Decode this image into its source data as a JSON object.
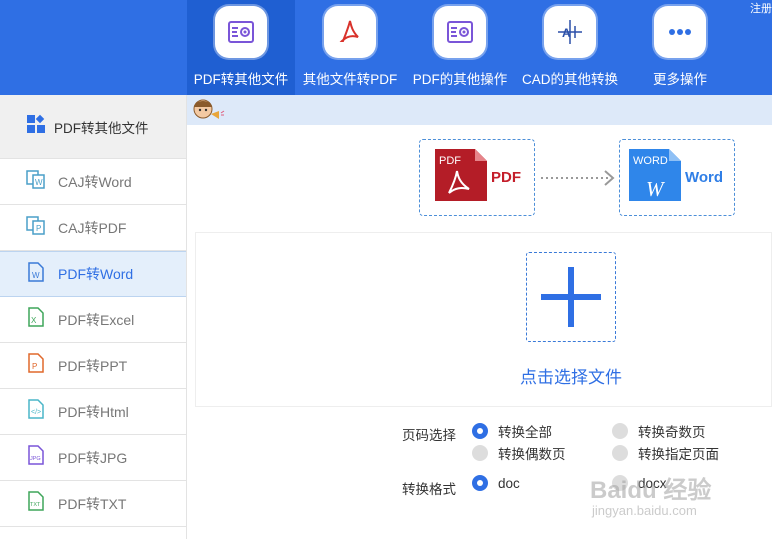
{
  "app": {
    "register_label": "注册"
  },
  "topnav": {
    "items": [
      {
        "label": "PDF转其他文件",
        "icon": "gear-document-icon",
        "active": true
      },
      {
        "label": "其他文件转PDF",
        "icon": "pdf-acrobat-icon",
        "active": false
      },
      {
        "label": "PDF的其他操作",
        "icon": "gear-document-icon",
        "active": false
      },
      {
        "label": "CAD的其他转换",
        "icon": "cad-icon",
        "active": false
      },
      {
        "label": "更多操作",
        "icon": "more-dots-icon",
        "active": false
      }
    ]
  },
  "sidebar": {
    "header": {
      "label": "PDF转其他文件",
      "icon": "grid-icon"
    },
    "items": [
      {
        "label": "CAJ转Word",
        "icon": "caj-word-icon",
        "active": false
      },
      {
        "label": "CAJ转PDF",
        "icon": "caj-pdf-icon",
        "active": false
      },
      {
        "label": "PDF转Word",
        "icon": "word-file-icon",
        "active": true
      },
      {
        "label": "PDF转Excel",
        "icon": "excel-file-icon",
        "active": false
      },
      {
        "label": "PDF转PPT",
        "icon": "ppt-file-icon",
        "active": false
      },
      {
        "label": "PDF转Html",
        "icon": "html-file-icon",
        "active": false
      },
      {
        "label": "PDF转JPG",
        "icon": "jpg-file-icon",
        "active": false
      },
      {
        "label": "PDF转TXT",
        "icon": "txt-file-icon",
        "active": false
      }
    ]
  },
  "conversion": {
    "from": {
      "badge": "PDF",
      "label": "PDF"
    },
    "to": {
      "badge": "WORD",
      "letter": "W",
      "label": "Word"
    }
  },
  "dropzone": {
    "choose_label": "点击选择文件"
  },
  "options": {
    "page_label": "页码选择",
    "page_options": [
      {
        "label": "转换全部",
        "checked": true
      },
      {
        "label": "转换奇数页",
        "checked": false
      },
      {
        "label": "转换偶数页",
        "checked": false
      },
      {
        "label": "转换指定页面",
        "checked": false
      }
    ],
    "format_label": "转换格式",
    "format_options": [
      {
        "label": "doc",
        "checked": true
      },
      {
        "label": "docx",
        "checked": false
      }
    ]
  },
  "watermark": {
    "text": "Baidu 经验",
    "sub": "jingyan.baidu.com"
  },
  "colors": {
    "brand_blue": "#2f6fe4",
    "pdf_red": "#c41e2a",
    "word_blue": "#2f7ee6"
  }
}
